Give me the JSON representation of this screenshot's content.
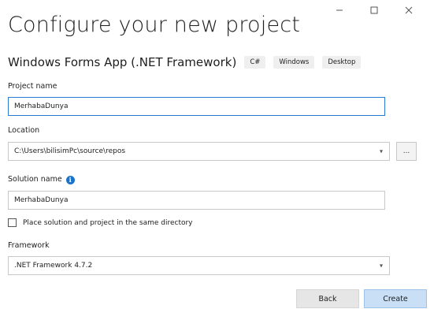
{
  "window": {
    "controls": [
      {
        "name": "minimize-button",
        "icon": "minimize-icon"
      },
      {
        "name": "maximize-button",
        "icon": "maximize-icon"
      },
      {
        "name": "close-button",
        "icon": "close-icon"
      }
    ]
  },
  "header": {
    "title": "Configure your new project",
    "subtitle": "Windows Forms App (.NET Framework)",
    "tags": [
      "C#",
      "Windows",
      "Desktop"
    ]
  },
  "form": {
    "project_name": {
      "label": "Project name",
      "value": "MerhabaDunya"
    },
    "location": {
      "label": "Location",
      "value": "C:\\Users\\bilisimPc\\source\\repos",
      "browse_label": "..."
    },
    "solution_name": {
      "label": "Solution name",
      "value": "MerhabaDunya",
      "info_icon": "info-icon"
    },
    "same_directory": {
      "label": "Place solution and project in the same directory",
      "checked": false
    },
    "framework": {
      "label": "Framework",
      "value": ".NET Framework 4.7.2"
    }
  },
  "footer": {
    "back_label": "Back",
    "create_label": "Create"
  },
  "colors": {
    "accent": "#2b7ad1",
    "create_button": "#c9dff5",
    "info_icon": "#1a73c9"
  }
}
